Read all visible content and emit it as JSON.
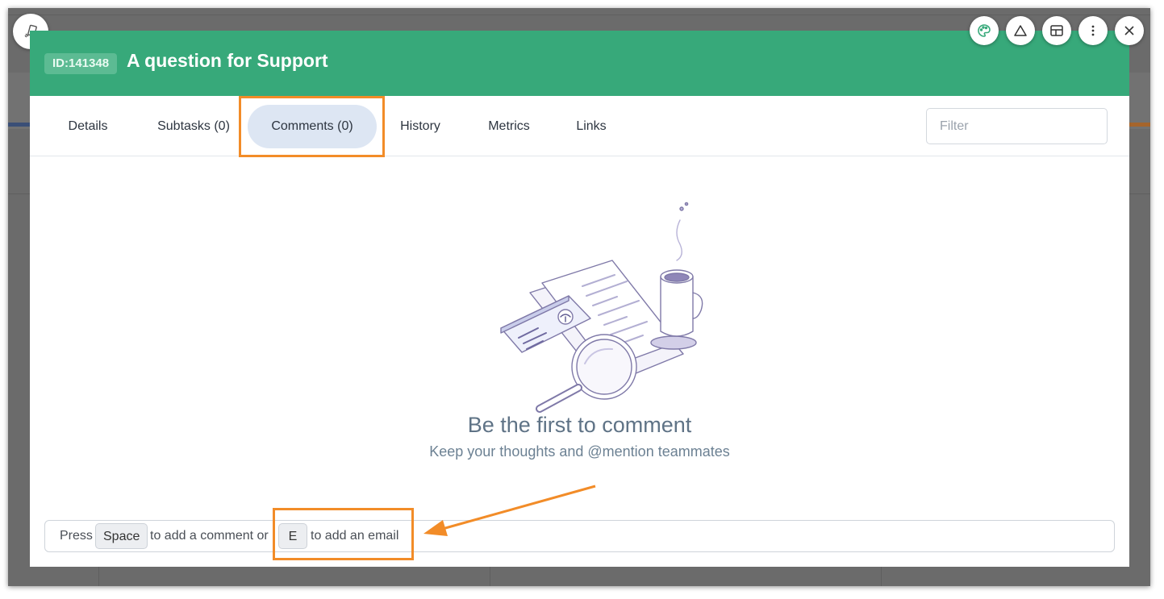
{
  "task": {
    "id_label": "ID:141348",
    "title": "A question for Support"
  },
  "tabs": [
    {
      "label": "Details"
    },
    {
      "label": "Subtasks (0)"
    },
    {
      "label": "Comments (0)",
      "active": true
    },
    {
      "label": "History"
    },
    {
      "label": "Metrics"
    },
    {
      "label": "Links"
    }
  ],
  "filter": {
    "placeholder": "Filter",
    "value": ""
  },
  "empty_state": {
    "title": "Be the first to comment",
    "subtitle": "Keep your thoughts and @mention teammates"
  },
  "comment_bar": {
    "press": "Press",
    "space_key": "Space",
    "middle": "to add a comment or",
    "e_key": "E",
    "end": "to add an email"
  },
  "toolbar_icons": [
    "device-rotate-icon",
    "palette-icon",
    "triangle-icon",
    "layout-icon",
    "more-vertical-icon",
    "close-icon"
  ],
  "colors": {
    "header": "#37a97a",
    "active_tab": "#dde6f3",
    "annotation": "#f28c28"
  }
}
